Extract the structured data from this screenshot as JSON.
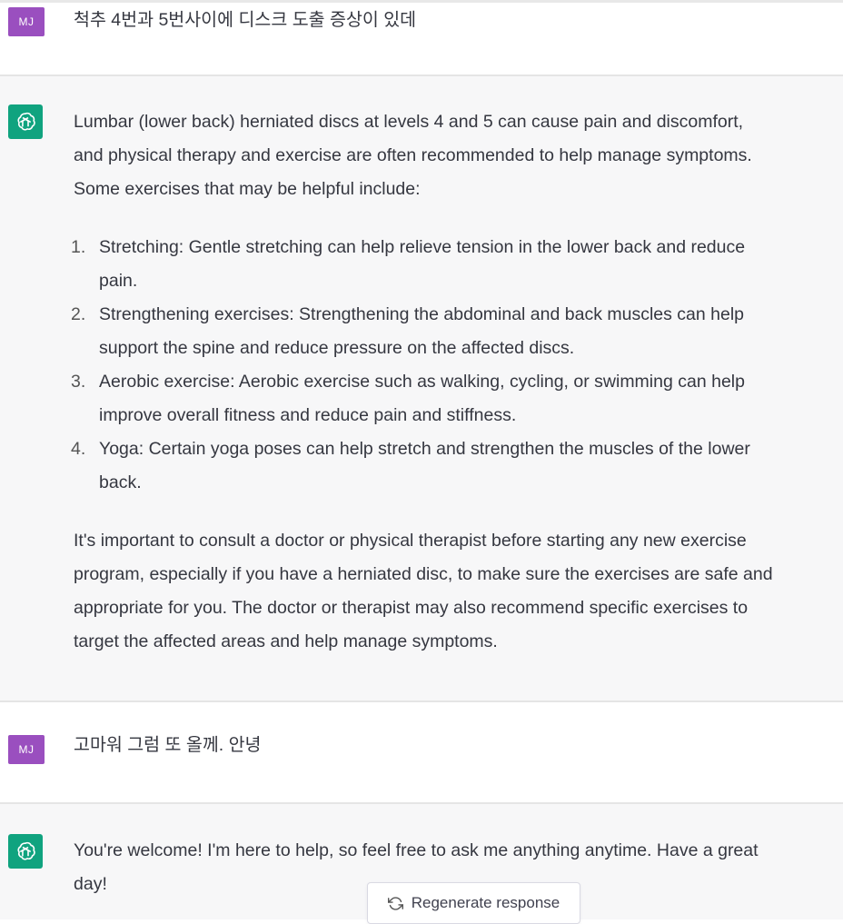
{
  "messages": [
    {
      "role": "user",
      "avatar_initials": "MJ",
      "text": "척추 4번과 5번사이에 디스크 도출 증상이 있데"
    },
    {
      "role": "assistant",
      "avatar_icon": "openai-logo-icon",
      "intro_lines": [
        "Lumbar (lower back) herniated discs at levels 4 and 5 can cause pain and discomfort,",
        "and physical therapy and exercise are often recommended to help manage symptoms.",
        "Some exercises that may be helpful include:"
      ],
      "list": [
        {
          "num": "1.",
          "lines": [
            "Stretching: Gentle stretching can help relieve tension in the lower back and reduce",
            "pain."
          ]
        },
        {
          "num": "2.",
          "lines": [
            "Strengthening exercises: Strengthening the abdominal and back muscles can help",
            "support the spine and reduce pressure on the affected discs."
          ]
        },
        {
          "num": "3.",
          "lines": [
            "Aerobic exercise: Aerobic exercise such as walking, cycling, or swimming can help",
            "improve overall fitness and reduce pain and stiffness."
          ]
        },
        {
          "num": "4.",
          "lines": [
            "Yoga: Certain yoga poses can help stretch and strengthen the muscles of the lower",
            "back."
          ]
        }
      ],
      "outro_lines": [
        "It's important to consult a doctor or physical therapist before starting any new exercise",
        "program, especially if you have a herniated disc, to make sure the exercises are safe and",
        "appropriate for you. The doctor or therapist may also recommend specific exercises to",
        "target the affected areas and help manage symptoms."
      ]
    },
    {
      "role": "user",
      "avatar_initials": "MJ",
      "text": "고마워 그럼 또 올께. 안녕"
    },
    {
      "role": "assistant",
      "avatar_icon": "openai-logo-icon",
      "lines": [
        "You're welcome! I'm here to help, so feel free to ask me anything anytime. Have a great",
        "day!"
      ]
    }
  ],
  "regenerate": {
    "label": "Regenerate response",
    "icon": "refresh-icon"
  },
  "colors": {
    "user_avatar": "#9a4fbf",
    "assistant_avatar": "#10a37f",
    "assistant_bg": "#f7f7f8"
  }
}
